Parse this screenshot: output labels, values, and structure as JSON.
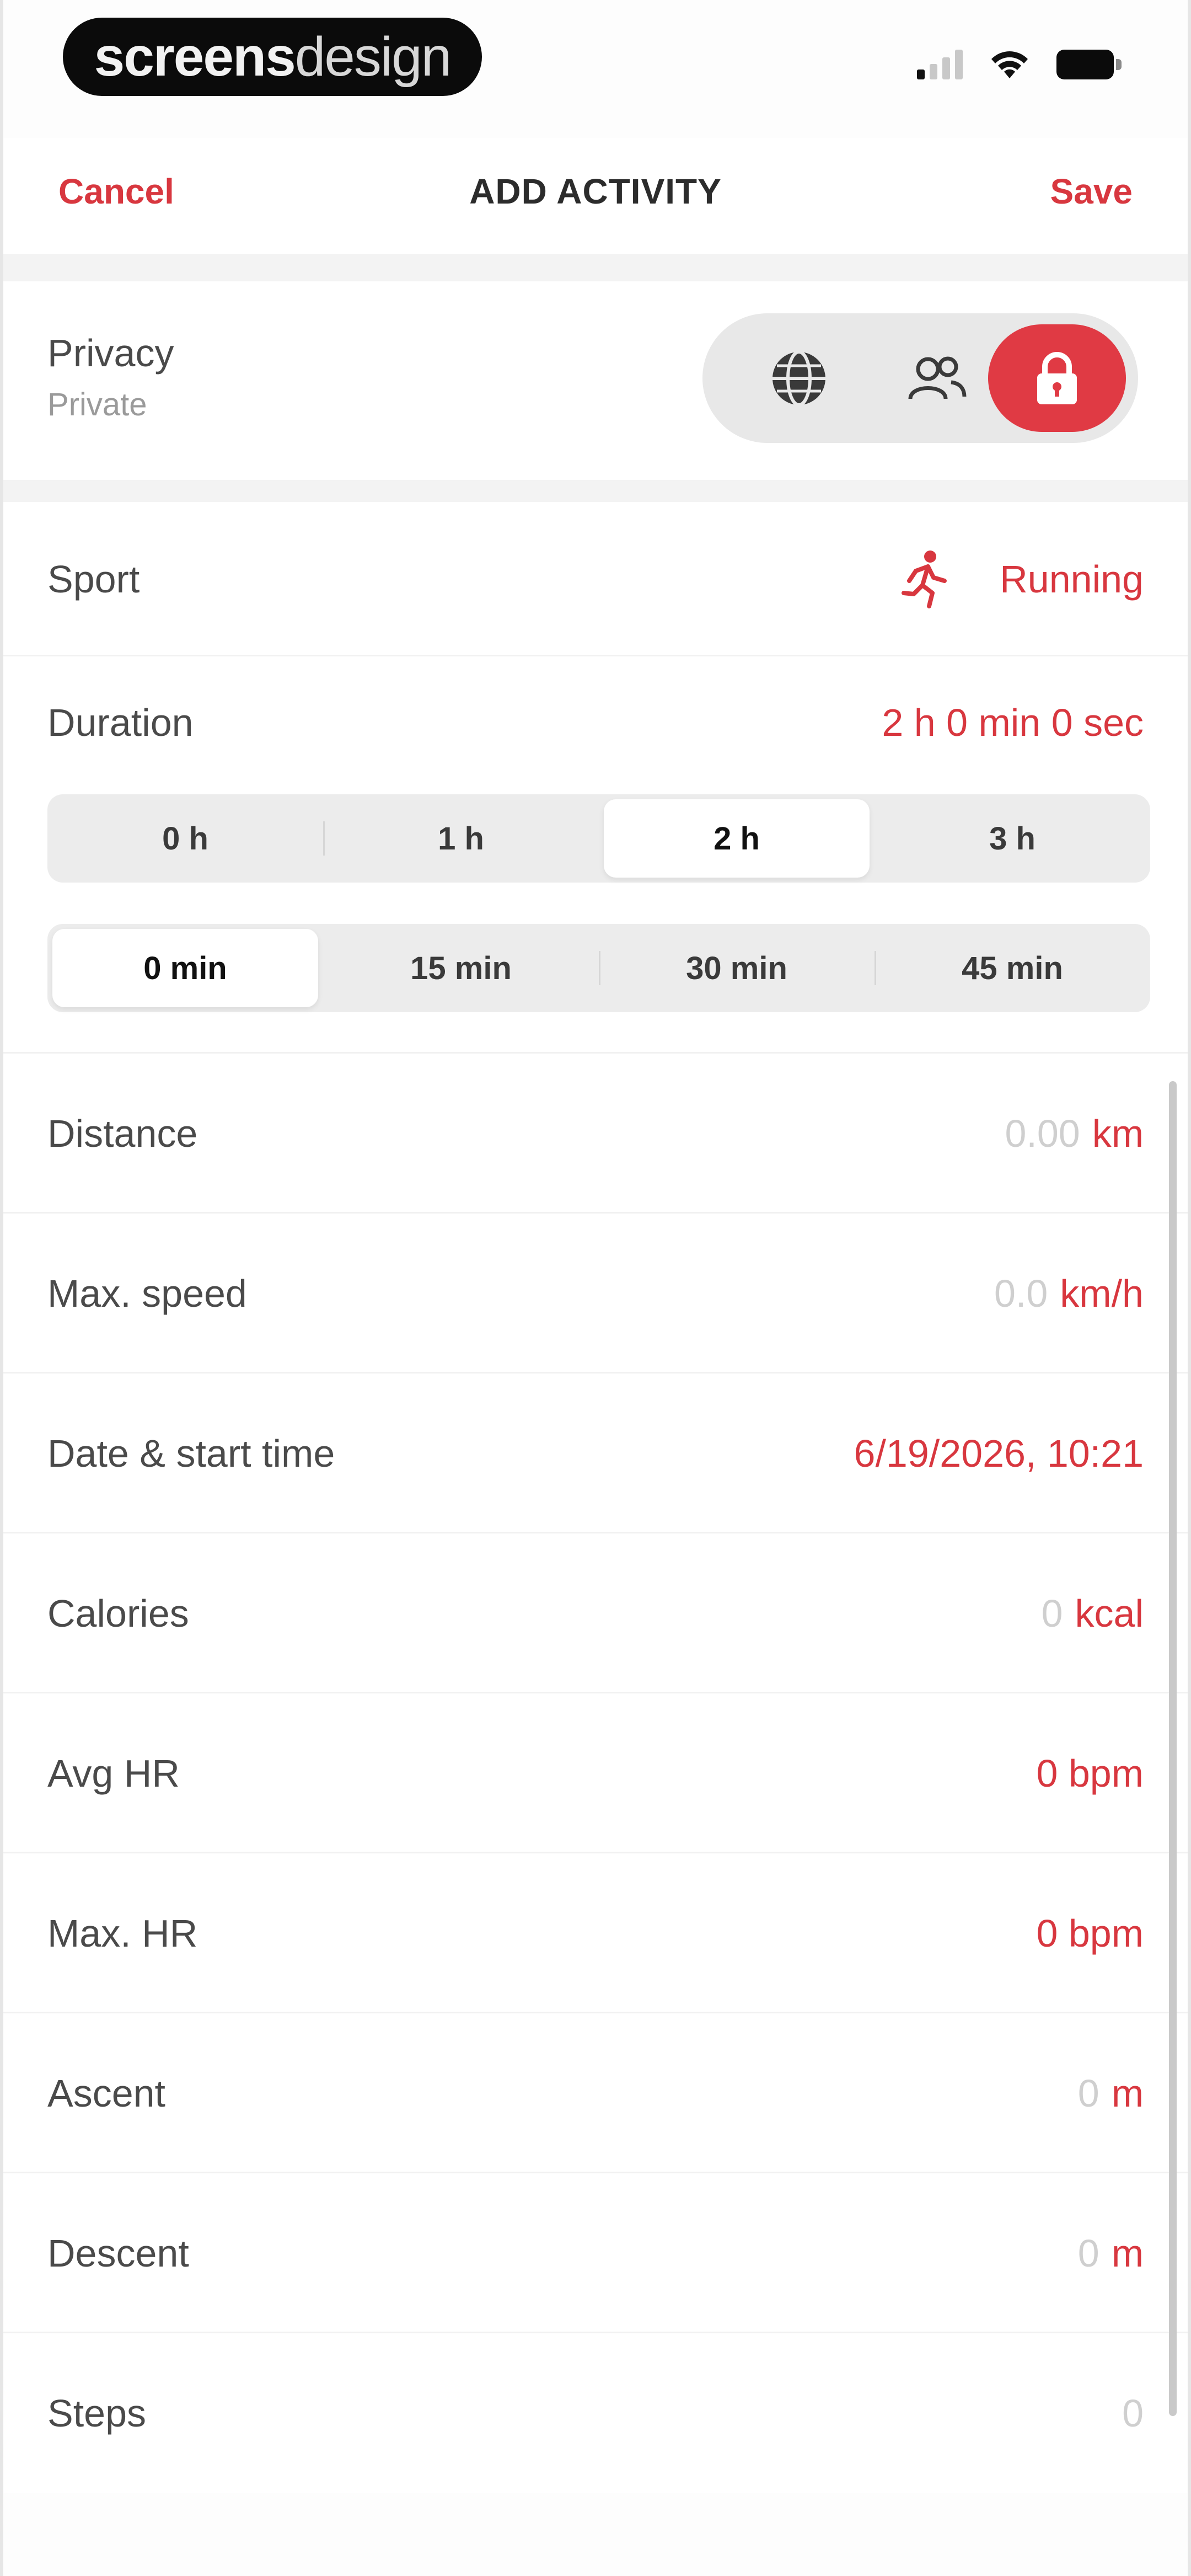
{
  "status_bar": {
    "brand_bold": "screens",
    "brand_light": "design"
  },
  "nav": {
    "cancel": "Cancel",
    "title": "ADD ACTIVITY",
    "save": "Save"
  },
  "privacy": {
    "label": "Privacy",
    "value": "Private",
    "options": [
      {
        "icon": "globe-icon",
        "selected": false
      },
      {
        "icon": "followers-icon",
        "selected": false
      },
      {
        "icon": "lock-icon",
        "selected": true
      }
    ]
  },
  "sport": {
    "label": "Sport",
    "value": "Running",
    "icon": "running-icon"
  },
  "duration": {
    "label": "Duration",
    "value": "2 h 0 min 0 sec",
    "hours": [
      "0 h",
      "1 h",
      "2 h",
      "3 h"
    ],
    "hours_selected": "2 h",
    "minutes": [
      "0 min",
      "15 min",
      "30 min",
      "45 min"
    ],
    "minutes_selected": "0 min"
  },
  "fields": [
    {
      "label": "Distance",
      "value": "0.00",
      "unit": "km"
    },
    {
      "label": "Max. speed",
      "value": "0.0",
      "unit": "km/h"
    },
    {
      "label": "Date & start time",
      "value": "6/19/2026, 10:21",
      "unit": ""
    },
    {
      "label": "Calories",
      "value": "0",
      "unit": "kcal"
    },
    {
      "label": "Avg HR",
      "value": "0 bpm",
      "unit": ""
    },
    {
      "label": "Max. HR",
      "value": "0 bpm",
      "unit": ""
    },
    {
      "label": "Ascent",
      "value": "0",
      "unit": "m"
    },
    {
      "label": "Descent",
      "value": "0",
      "unit": "m"
    },
    {
      "label": "Steps",
      "value": "0",
      "unit": ""
    }
  ],
  "colors": {
    "accent": "#d8373f",
    "placeholder": "#cfcfcf",
    "background": "#f3f3f3"
  }
}
